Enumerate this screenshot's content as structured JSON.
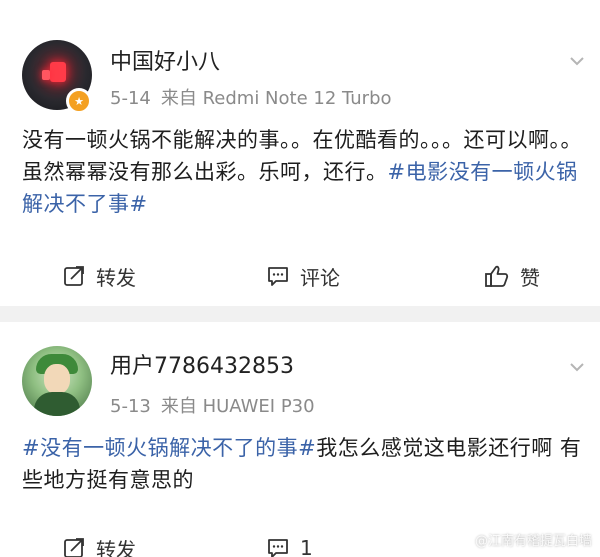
{
  "posts": [
    {
      "username": "中国好小八",
      "date": "5-14",
      "source": "来自 Redmi Note 12 Turbo",
      "content_text": "没有一顿火锅不能解决的事。。在优酷看的。。。还可以啊。。虽然幂幂没有那么出彩。乐呵，还行。",
      "content_tag": "#电影没有一顿火锅解决不了事#",
      "actions": {
        "repost": "转发",
        "comment": "评论",
        "like": "赞"
      }
    },
    {
      "username": "用户7786432853",
      "date": "5-13",
      "source": "来自 HUAWEI P30",
      "content_tag": "#没有一顿火锅解决不了的事#",
      "content_text": "我怎么感觉这电影还行啊 有些地方挺有意思的",
      "actions": {
        "repost": "转发",
        "comment": "1",
        "like": ""
      }
    }
  ],
  "watermark": "@江南有稽提瓦白墙",
  "colors": {
    "tag": "#3b63a8",
    "meta": "#8a8a8a",
    "badge": "#f4a021"
  },
  "icons": [
    "repost-icon",
    "comment-icon",
    "like-icon",
    "chevron-down-icon",
    "verified-badge-icon"
  ]
}
